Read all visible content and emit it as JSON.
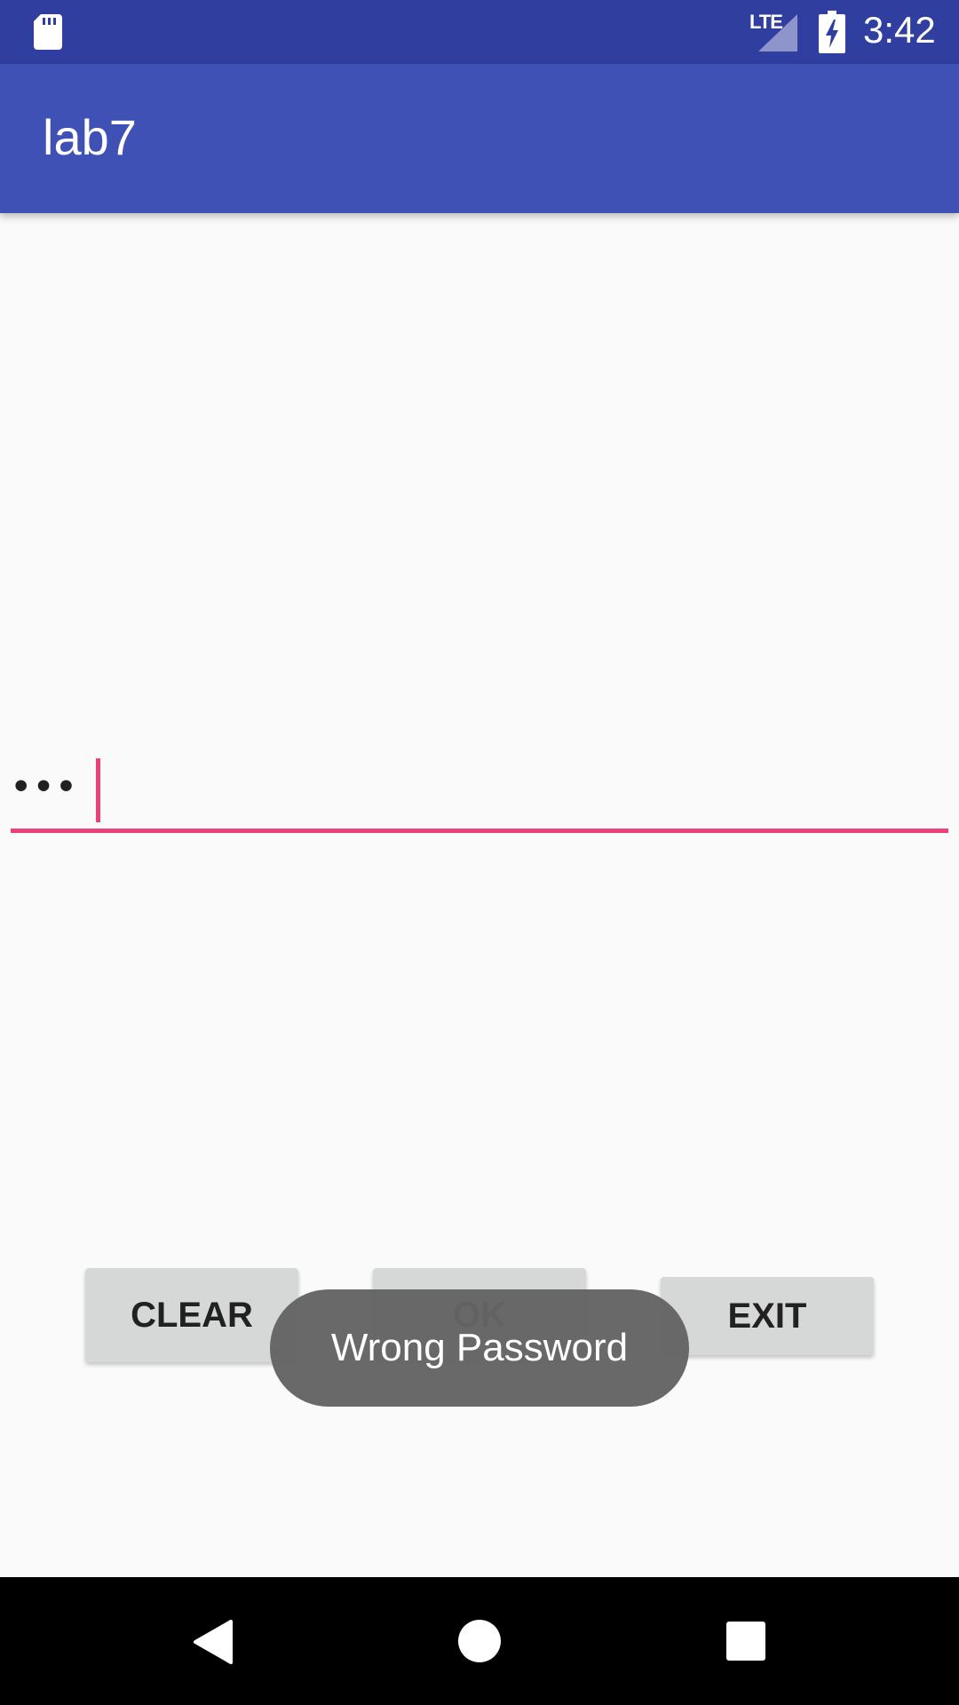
{
  "status_bar": {
    "network": "LTE",
    "time": "3:42",
    "icons": [
      "sd-card-icon",
      "signal-icon",
      "battery-charging-icon"
    ]
  },
  "app_bar": {
    "title": "lab7"
  },
  "password_field": {
    "masked_value": "•••",
    "accent_color": "#ec407a"
  },
  "buttons": {
    "clear": "CLEAR",
    "ok": "OK",
    "exit": "EXIT"
  },
  "toast": {
    "message": "Wrong Password"
  },
  "nav_bar": {
    "icons": [
      "back-icon",
      "home-icon",
      "recents-icon"
    ]
  },
  "colors": {
    "status_bar": "#303f9f",
    "app_bar": "#3f51b5",
    "background": "#fafafa",
    "button": "#d6d7d7",
    "toast": "#646464"
  }
}
